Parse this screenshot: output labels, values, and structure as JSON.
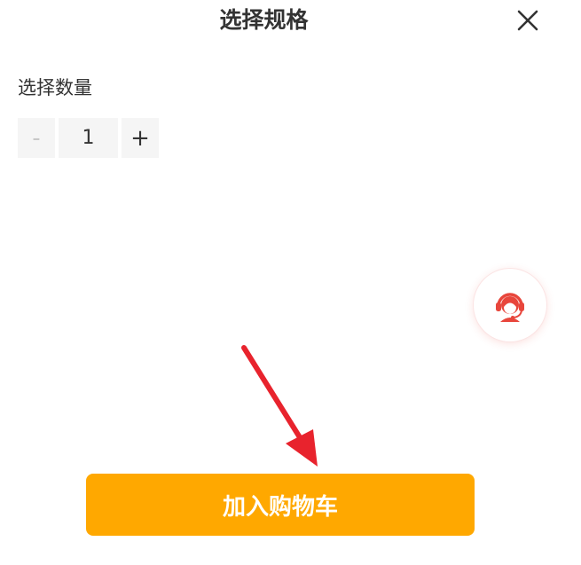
{
  "sheet": {
    "title": "选择规格",
    "close_icon": "close-icon"
  },
  "quantity": {
    "label": "选择数量",
    "minus": "-",
    "value": "1",
    "plus": "+"
  },
  "service": {
    "icon": "customer-service-icon",
    "color": "#e8463c"
  },
  "annotation": {
    "icon": "red-arrow-icon",
    "color": "#e8232d"
  },
  "cart": {
    "label": "加入购物车",
    "color": "#ffa800"
  }
}
